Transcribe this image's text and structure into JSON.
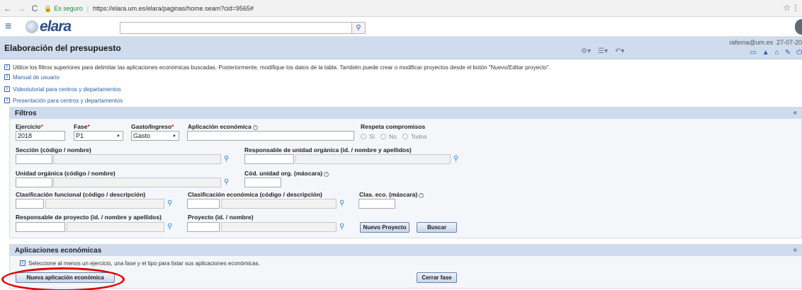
{
  "browser": {
    "secure_label": "Es seguro",
    "url": "https://elara.um.es/elara/paginas/home.seam?cid=9565#",
    "icons": [
      "back-icon",
      "forward-icon",
      "reload-icon",
      "lock-icon",
      "star-icon",
      "menu-kebab-icon"
    ]
  },
  "app": {
    "logo_text": "elara",
    "search_placeholder": "",
    "page_title": "Elaboración del presupuesto",
    "user_email": "rafema@um.es",
    "date": "27-07-20"
  },
  "info": {
    "instructions": "Utilice los filtros superiores para delimitar las aplicaciones económicas buscadas. Posteriormente, modifique los datos de la tabla. También puede crear o modificar proyectos desde el botón \"Nuevo/Editar proyecto\".",
    "links": [
      "Manual de usuario",
      "Videotutorial para centros y departamentos",
      "Presentación para centros y departamentos"
    ]
  },
  "filtros": {
    "title": "Filtros",
    "collapse": "«",
    "ejercicio_label": "Ejercicio",
    "ejercicio_value": "2018",
    "fase_label": "Fase",
    "fase_value": "P1",
    "gasto_label": "Gasto/Ingreso",
    "gasto_value": "Gasto",
    "aplicacion_label": "Aplicación económica",
    "respeta_label": "Respeta compromisos",
    "respeta_options": [
      "Sí",
      "No",
      "Todos"
    ],
    "seccion_label": "Sección (código / nombre)",
    "responsable_unidad_label": "Responsable de unidad orgánica (id. / nombre y apellidos)",
    "unidad_label": "Unidad orgánica (código / nombre)",
    "cod_unidad_label": "Cód. unidad org. (máscara)",
    "clas_funcional_label": "Clasificación funcional (código / descripción)",
    "clas_economica_label": "Clasificación económica (código / descripción)",
    "clas_eco_label": "Clas. eco. (máscara)",
    "responsable_proyecto_label": "Responsable de proyecto (id. / nombre y apellidos)",
    "proyecto_label": "Proyecto (id. / nombre)",
    "nuevo_proyecto_btn": "Nuevo Proyecto",
    "buscar_btn": "Buscar"
  },
  "aplicaciones": {
    "title": "Aplicaciones económicas",
    "collapse": "«",
    "message": "Seleccione al menos un ejercicio, una fase y el tipo para listar sus aplicaciones económicas.",
    "nueva_btn": "Nueva aplicación económica",
    "cerrar_btn": "Cerrar fase"
  },
  "colors": {
    "accent": "#2b62a8",
    "panel_header": "#cfdcee",
    "annotation": "#e10000"
  }
}
